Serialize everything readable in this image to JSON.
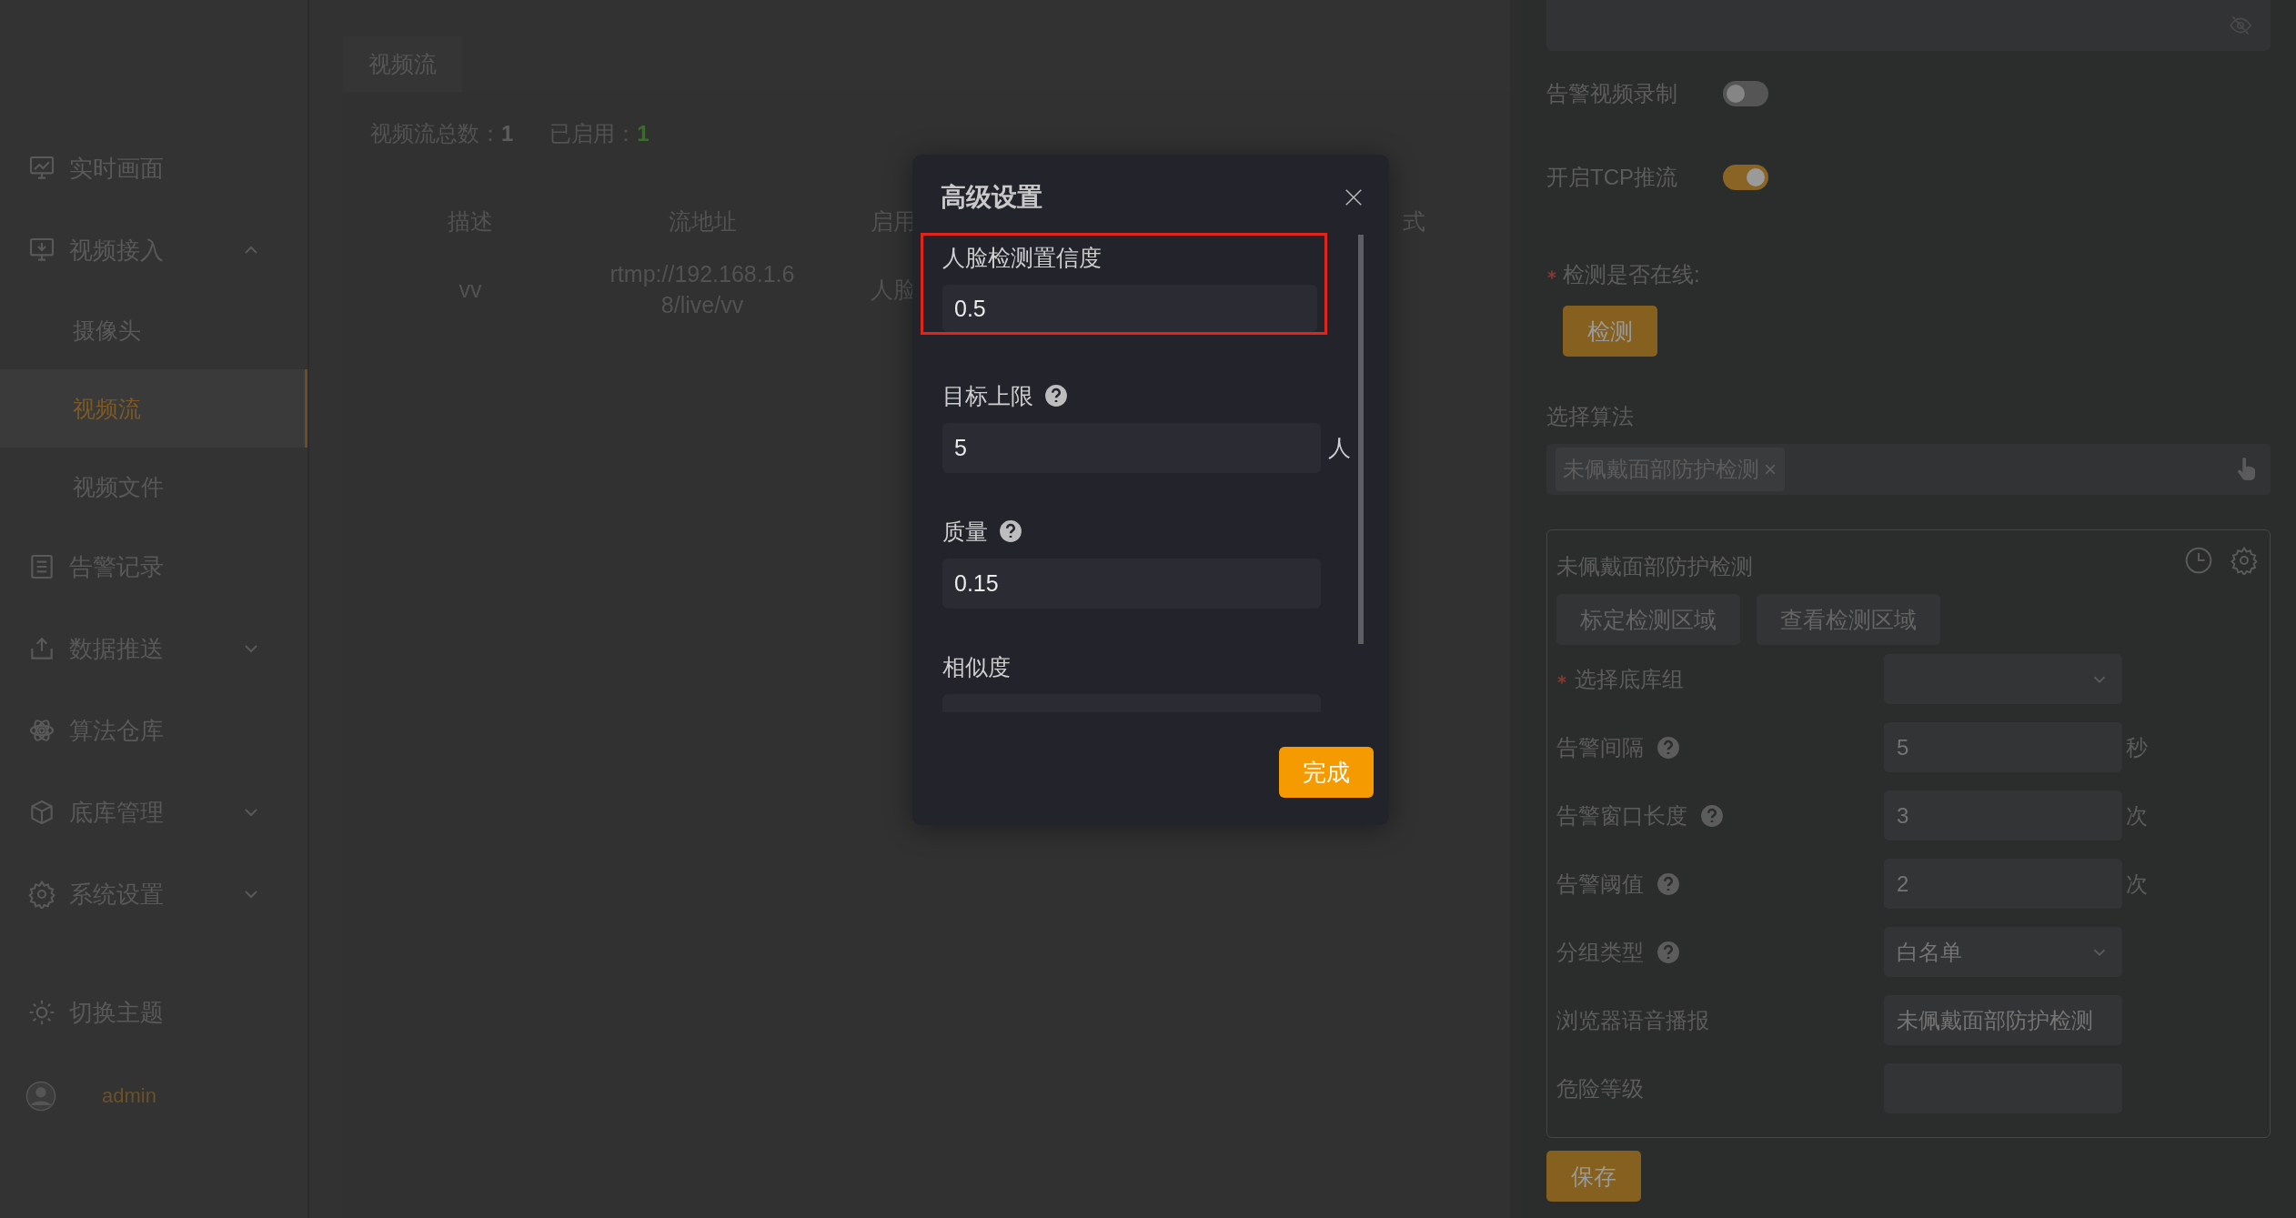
{
  "sidebar": {
    "items": [
      {
        "label": "实时画面",
        "kind": "link",
        "selected": false
      },
      {
        "label": "视频接入",
        "kind": "group",
        "selected": false,
        "expanded": true,
        "children": [
          {
            "label": "摄像头",
            "selected": false
          },
          {
            "label": "视频流",
            "selected": true
          },
          {
            "label": "视频文件",
            "selected": false
          }
        ]
      },
      {
        "label": "告警记录",
        "kind": "link",
        "selected": false
      },
      {
        "label": "数据推送",
        "kind": "group",
        "selected": false,
        "expanded": false
      },
      {
        "label": "算法仓库",
        "kind": "link",
        "selected": false
      },
      {
        "label": "底库管理",
        "kind": "group",
        "selected": false,
        "expanded": false
      },
      {
        "label": "系统设置",
        "kind": "group",
        "selected": false,
        "expanded": false
      }
    ],
    "theme_toggle": "切换主题",
    "user": "admin"
  },
  "main": {
    "tabs": [
      {
        "label": "视频流",
        "selected": true
      }
    ],
    "stats": [
      {
        "label": "视频流总数：",
        "value": "1",
        "kind": "plain"
      },
      {
        "label": "已启用：",
        "value": "1",
        "kind": "good"
      }
    ],
    "table": {
      "columns": [
        "描述",
        "流地址",
        "启用",
        "式"
      ],
      "rows": [
        [
          "vv",
          "rtmp://192.168.1.68/live/vv",
          "人脸",
          ""
        ]
      ]
    }
  },
  "dialog": {
    "title": "高级设置",
    "fields": [
      {
        "label": "人脸检测置信度",
        "help": false,
        "value": "0.5",
        "highlighted": true
      },
      {
        "label": "目标上限",
        "help": true,
        "value": "5",
        "unit": "人",
        "highlighted": false
      },
      {
        "label": "质量",
        "help": true,
        "value": "0.15",
        "highlighted": false
      },
      {
        "label": "相似度",
        "help": false,
        "highlighted": false
      }
    ],
    "confirm": "完成"
  },
  "panel": {
    "toggles": [
      {
        "label": "告警视频录制",
        "on": false
      },
      {
        "label": "开启TCP推流",
        "on": true
      }
    ],
    "online_check": {
      "label": "检测是否在线:",
      "required": true,
      "button": "检测"
    },
    "algorithm": {
      "label": "选择算法",
      "tags": [
        "未佩戴面部防护检测"
      ]
    },
    "card": {
      "title": "未佩戴面部防护检测",
      "buttons": [
        "标定检测区域",
        "查看检测区域"
      ],
      "rows": [
        {
          "label": "选择底库组",
          "required": true,
          "help": false,
          "kind": "select"
        },
        {
          "label": "告警间隔",
          "required": false,
          "help": true,
          "kind": "input",
          "value": "5",
          "unit": "秒"
        },
        {
          "label": "告警窗口长度",
          "required": false,
          "help": true,
          "kind": "input",
          "value": "3",
          "unit": "次"
        },
        {
          "label": "告警阈值",
          "required": false,
          "help": true,
          "kind": "input",
          "value": "2",
          "unit": "次"
        },
        {
          "label": "分组类型",
          "required": false,
          "help": true,
          "kind": "select",
          "value": "白名单"
        },
        {
          "label": "浏览器语音播报",
          "required": false,
          "help": false,
          "kind": "input",
          "value": "未佩戴面部防护检测"
        },
        {
          "label": "危险等级",
          "required": false,
          "help": false,
          "kind": "input"
        }
      ]
    },
    "save": "保存"
  }
}
